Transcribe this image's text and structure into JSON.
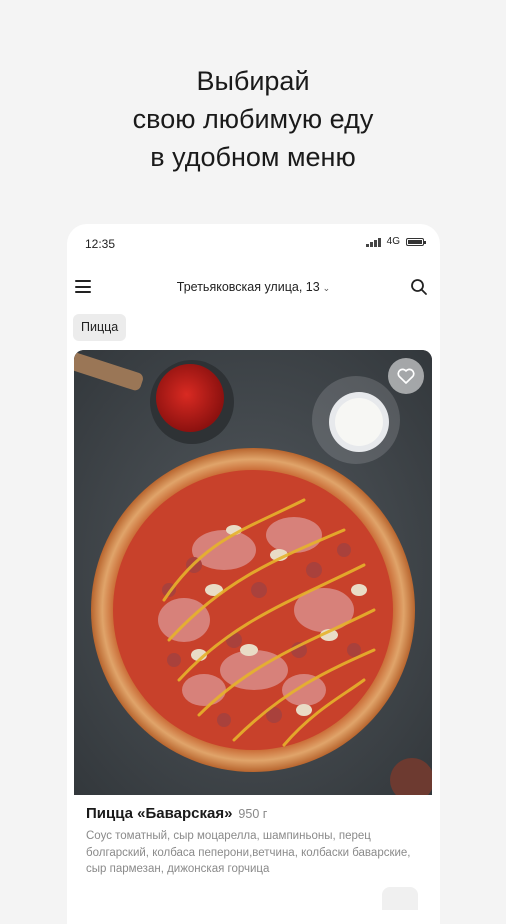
{
  "promo": {
    "line1": "Выбирай",
    "line2": "свою любимую еду",
    "line3": "в удобном меню"
  },
  "status_bar": {
    "time": "12:35",
    "network": "4G"
  },
  "header": {
    "address": "Третьяковская улица, 13"
  },
  "category_chip": "Пицца",
  "product": {
    "name": "Пицца «Баварская»",
    "weight": "950 г",
    "description": "Соус томатный, сыр моцарелла, шампиньоны, перец болгарский, колбаса пеперони,ветчина, колбаски баварские, сыр пармезан, дижонская горчица"
  },
  "colors": {
    "background": "#f4f4f4",
    "card": "#ffffff",
    "photo_backdrop": "#3f4448",
    "crust": "#d9843f",
    "sauce": "#c8412b"
  },
  "icons": [
    "menu-icon",
    "chevron-down-icon",
    "search-icon",
    "heart-icon",
    "signal-icon",
    "battery-icon"
  ]
}
